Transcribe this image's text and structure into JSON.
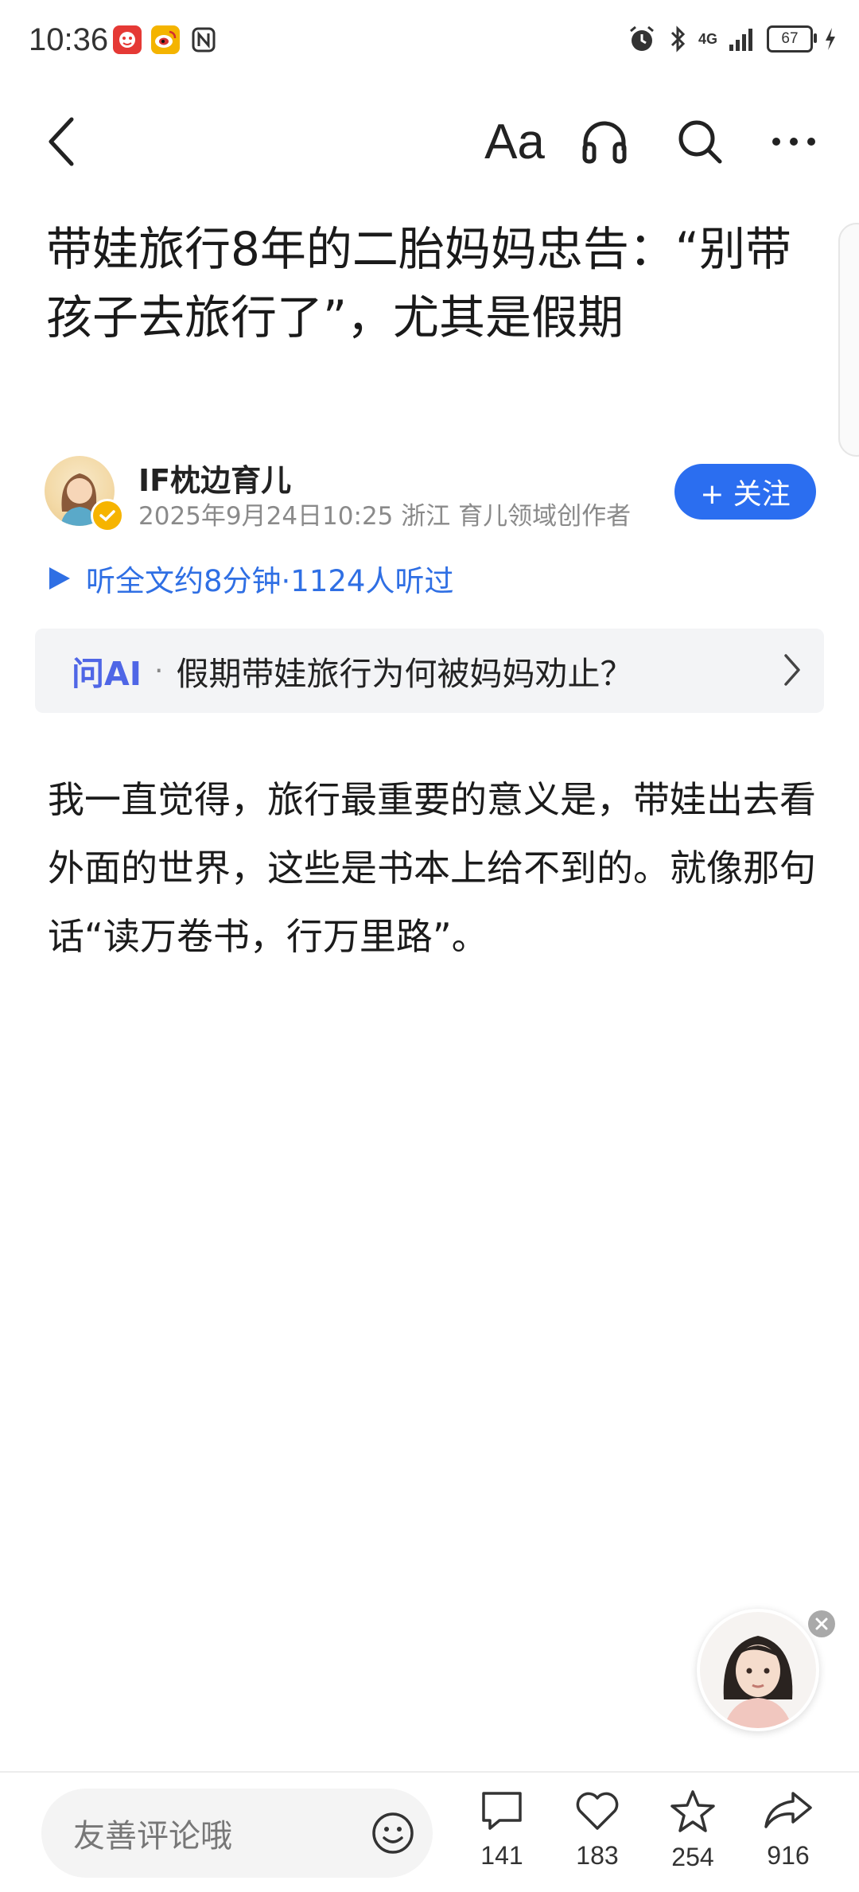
{
  "status_bar": {
    "time": "10:36",
    "battery": "67",
    "network": "4G"
  },
  "toolbar": {
    "font_label": "Aa"
  },
  "article": {
    "title": "带娃旅行8年的二胎妈妈忠告：“别带孩子去旅行了”，尤其是假期",
    "body": "我一直觉得，旅行最重要的意义是，带娃出去看外面的世界，这些是书本上给不到的。就像那句话“读万卷书，行万里路”。"
  },
  "author": {
    "name": "IF枕边育儿",
    "meta": "2025年9月24日10:25 浙江 育儿领域创作者",
    "follow_label": "+ 关注"
  },
  "listen": {
    "label": "听全文约8分钟·1124人听过"
  },
  "ask_ai": {
    "label": "问AI",
    "separator": "·",
    "question": "假期带娃旅行为何被妈妈劝止？"
  },
  "bottom_bar": {
    "comment_placeholder": "友善评论哦",
    "comments": "141",
    "likes": "183",
    "favorites": "254",
    "shares": "916"
  },
  "colors": {
    "accent": "#2b6ef0",
    "ai_label": "#4f66e6",
    "listen": "#2f6fe4"
  }
}
